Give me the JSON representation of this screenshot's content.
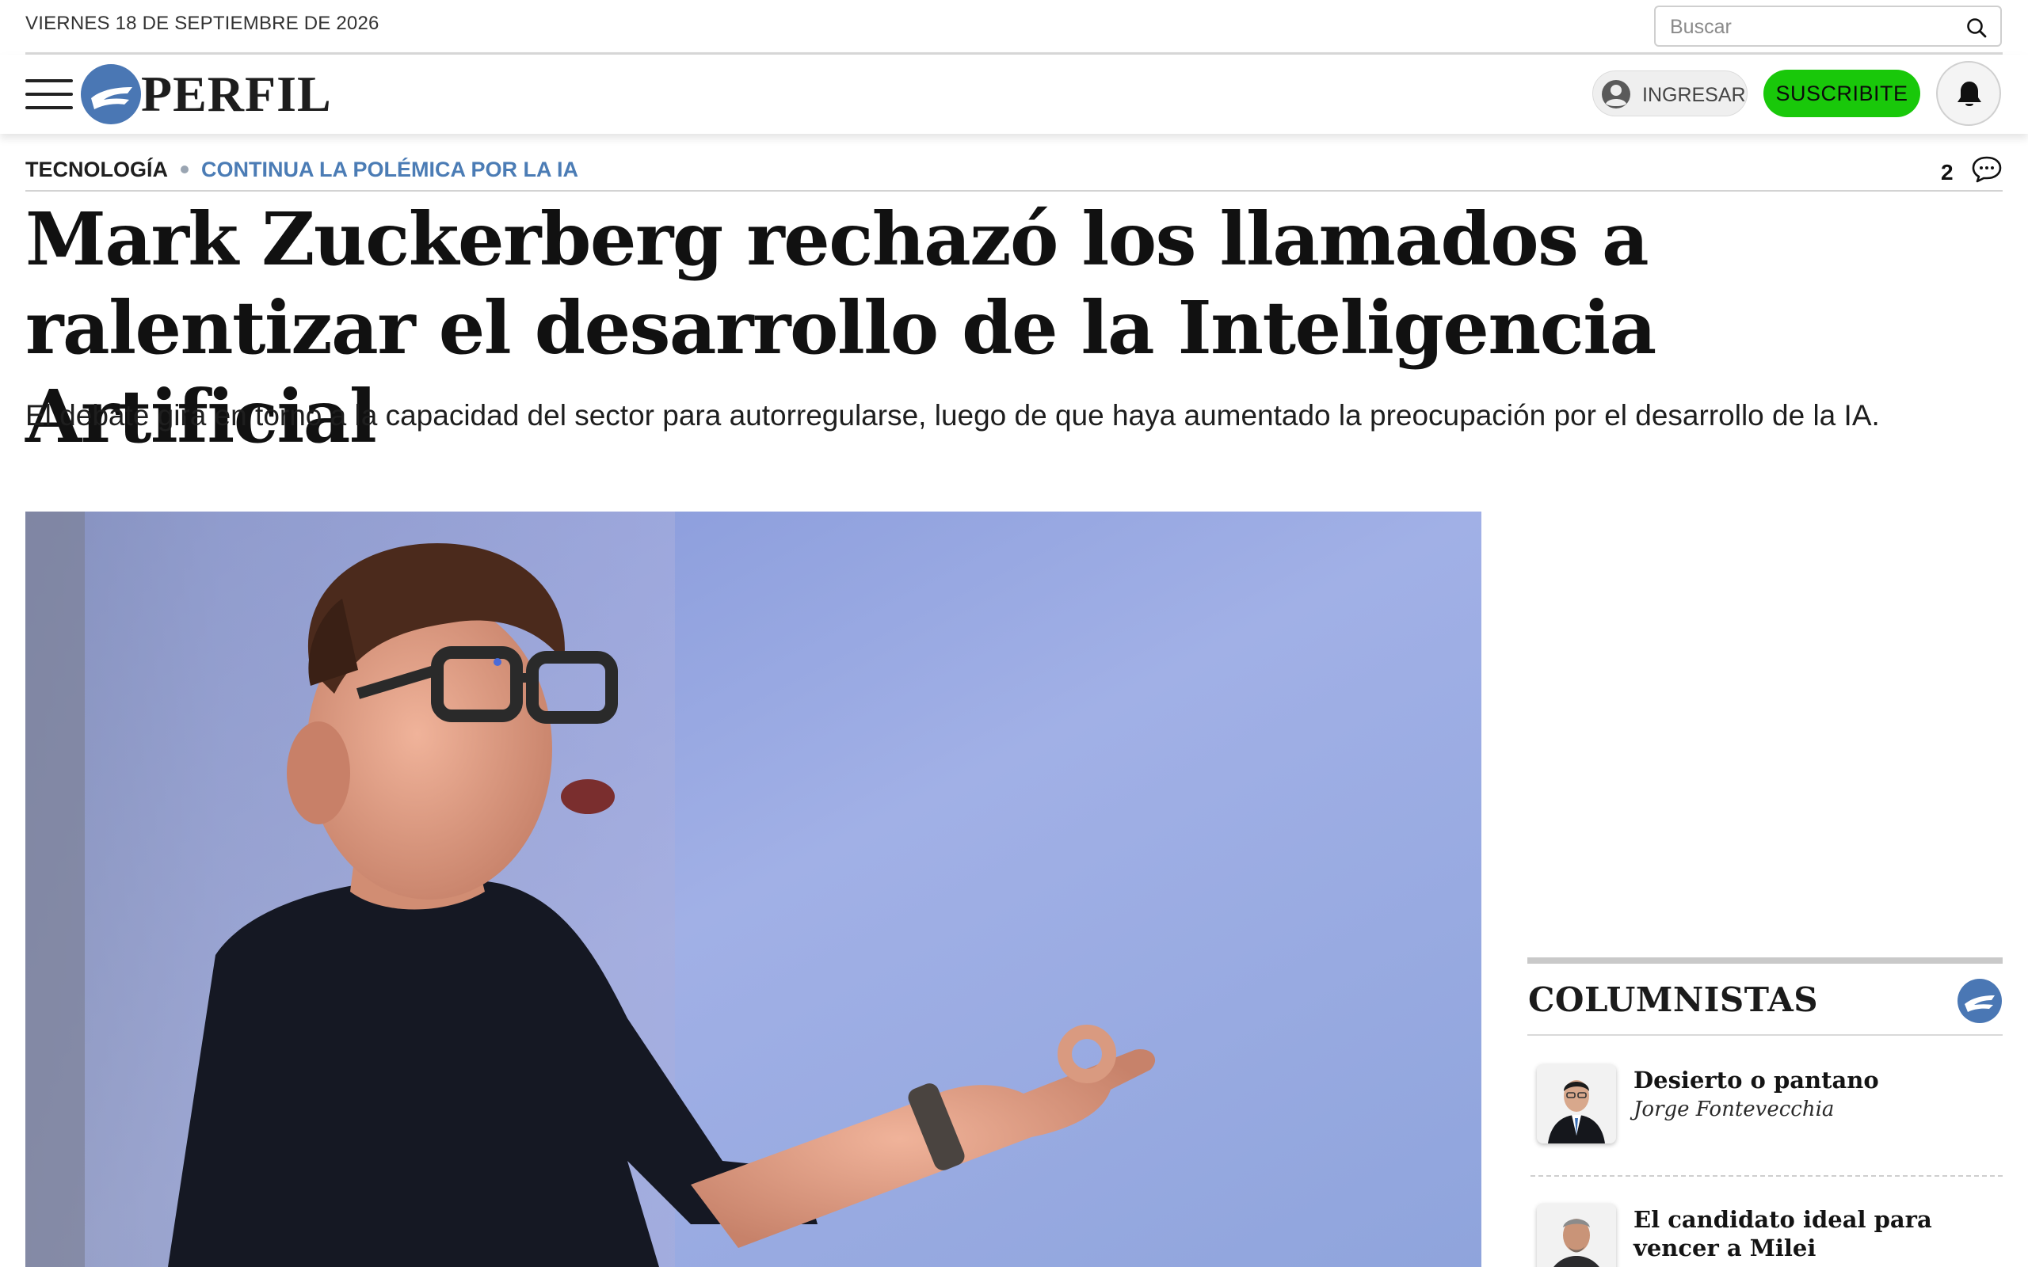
{
  "date": "VIERNES 18 DE SEPTIEMBRE DE 2026",
  "search": {
    "placeholder": "Buscar"
  },
  "brand": {
    "name": "PERFIL",
    "color": "#4a77b4"
  },
  "nav": {
    "login_label": "INGRESAR",
    "subscribe_label": "SUSCRIBITE",
    "subscribe_color": "#19c80a"
  },
  "article": {
    "section": "TECNOLOGÍA",
    "kicker": "CONTINUA LA POLÉMICA POR LA IA",
    "comments_count": "2",
    "headline": "Mark Zuckerberg rechazó los llamados a ralentizar el desarrollo de la Inteligencia Artificial",
    "subtitle": "El debate gira en torno a la capacidad del sector para autorregularse, luego de que haya aumentado la preocupación por el desarrollo de la IA."
  },
  "columnistas": {
    "title": "COLUMNISTAS",
    "items": [
      {
        "title": "Desierto o pantano",
        "author": "Jorge Fontevecchia"
      },
      {
        "title": "El candidato ideal para vencer a Milei",
        "author": ""
      }
    ]
  }
}
